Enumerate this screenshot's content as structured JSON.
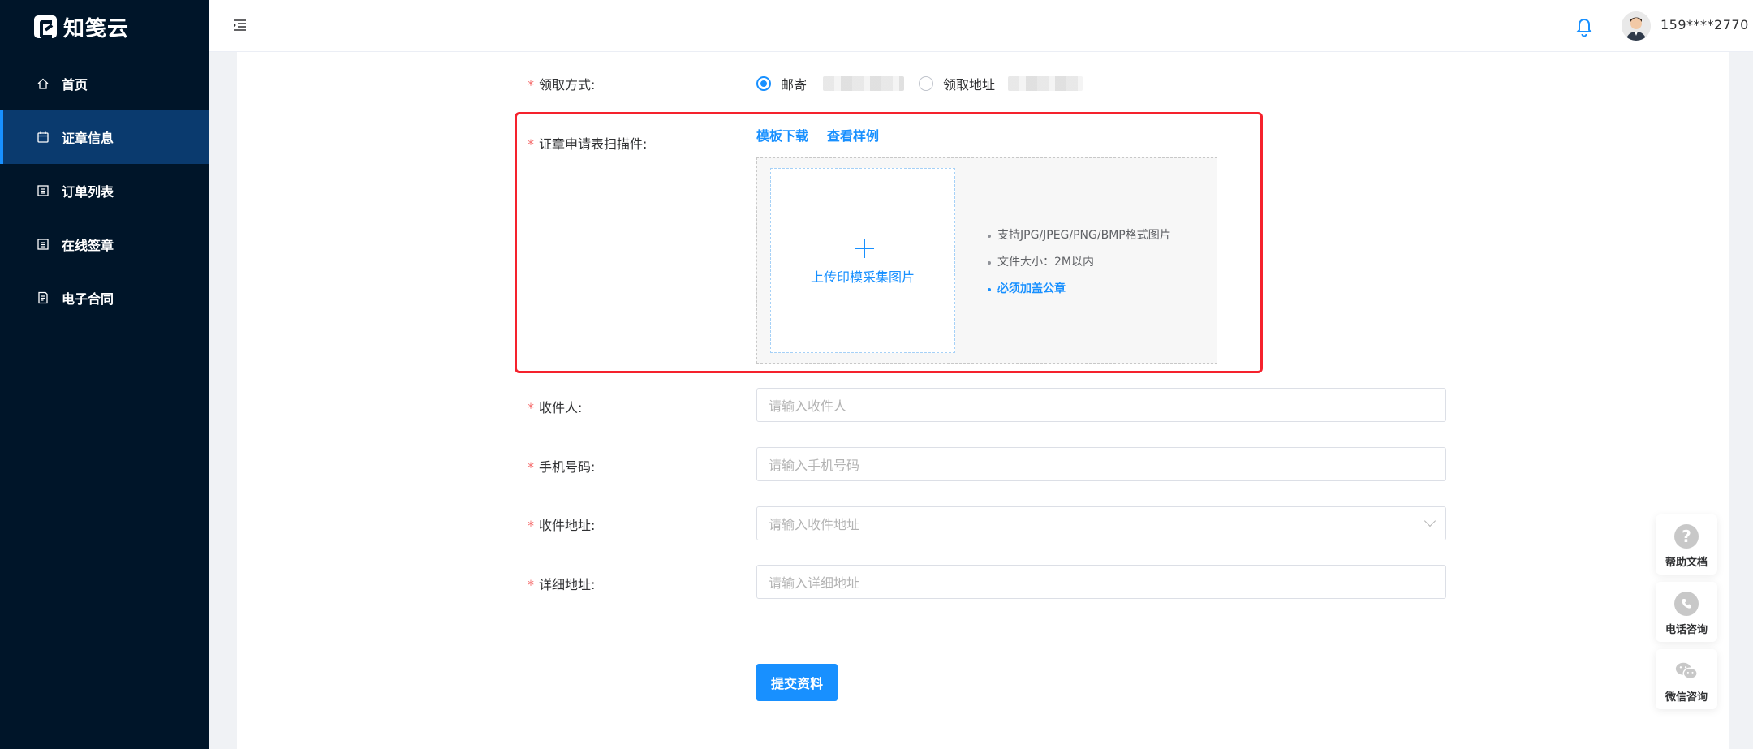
{
  "app": {
    "logo_text": "知笺云"
  },
  "sidebar": {
    "items": [
      {
        "label": "首页",
        "icon": "home-icon",
        "active": false
      },
      {
        "label": "证章信息",
        "icon": "calendar-icon",
        "active": true
      },
      {
        "label": "订单列表",
        "icon": "list-icon",
        "active": false
      },
      {
        "label": "在线签章",
        "icon": "list-icon",
        "active": false
      },
      {
        "label": "电子合同",
        "icon": "document-icon",
        "active": false
      }
    ]
  },
  "header": {
    "username": "159****2770"
  },
  "form": {
    "pickup_method": {
      "label": "领取方式:",
      "options": [
        {
          "label": "邮寄",
          "checked": true
        },
        {
          "label": "领取地址",
          "checked": false
        }
      ]
    },
    "scan_file": {
      "label": "证章申请表扫描件:",
      "template_link": "模板下载",
      "sample_link": "查看样例",
      "upload_text": "上传印模采集图片",
      "tips": [
        "支持JPG/JPEG/PNG/BMP格式图片",
        "文件大小：2M以内",
        "必须加盖公章"
      ]
    },
    "recipient": {
      "label": "收件人:",
      "placeholder": "请输入收件人"
    },
    "phone": {
      "label": "手机号码:",
      "placeholder": "请输入手机号码"
    },
    "address": {
      "label": "收件地址:",
      "placeholder": "请输入收件地址"
    },
    "detail_address": {
      "label": "详细地址:",
      "placeholder": "请输入详细地址"
    },
    "submit_label": "提交资料"
  },
  "float_help": [
    {
      "label": "帮助文档",
      "icon": "question-icon"
    },
    {
      "label": "电话咨询",
      "icon": "phone-icon"
    },
    {
      "label": "微信咨询",
      "icon": "wechat-icon"
    }
  ],
  "colors": {
    "primary": "#1890ff",
    "sidebar_bg": "#001529",
    "highlight_border": "#f5222d",
    "required": "#f56c6c"
  }
}
